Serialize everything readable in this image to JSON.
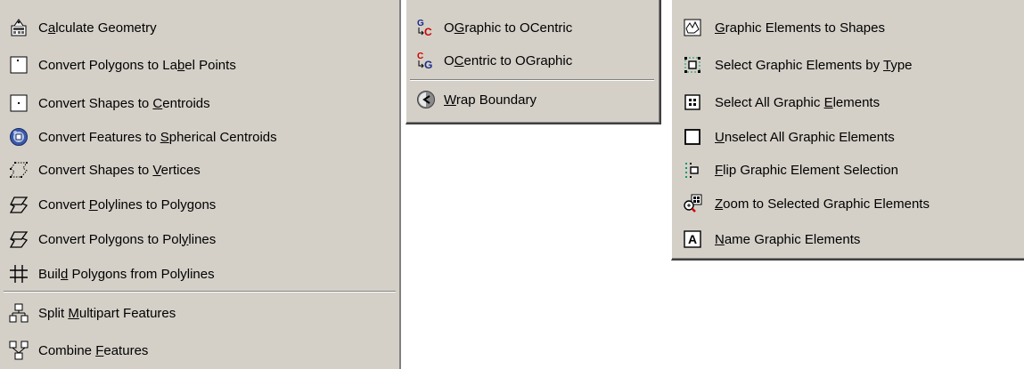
{
  "menu1": {
    "items": [
      {
        "pre": "C",
        "u": "a",
        "post": "lculate Geometry",
        "icon": "calculate-geometry-icon"
      },
      {
        "pre": "Convert Polygons to La",
        "u": "b",
        "post": "el Points",
        "icon": "label-points-icon"
      },
      {
        "pre": "Convert Shapes to ",
        "u": "C",
        "post": "entroids",
        "icon": "centroid-icon"
      },
      {
        "pre": "Convert Features to ",
        "u": "S",
        "post": "pherical Centroids",
        "icon": "spherical-centroid-icon"
      },
      {
        "pre": "Convert Shapes to ",
        "u": "V",
        "post": "ertices",
        "icon": "vertices-icon"
      },
      {
        "pre": "Convert ",
        "u": "P",
        "post": "olylines to Polygons",
        "icon": "polylines-to-polygons-icon"
      },
      {
        "pre": "Convert Polygons to Pol",
        "u": "y",
        "post": "lines",
        "icon": "polygons-to-polylines-icon"
      },
      {
        "pre": "Buil",
        "u": "d",
        "post": " Polygons from Polylines",
        "icon": "build-polygons-icon"
      },
      {
        "pre": "Split ",
        "u": "M",
        "post": "ultipart Features",
        "icon": "split-multipart-icon"
      },
      {
        "pre": "Combine ",
        "u": "F",
        "post": "eatures",
        "icon": "combine-features-icon"
      }
    ]
  },
  "menu2": {
    "items": [
      {
        "pre": "O",
        "u": "G",
        "post": "raphic to OCentric",
        "icon": "graphic-to-centric-icon",
        "badge_top": "G",
        "badge_bottom": "C"
      },
      {
        "pre": "O",
        "u": "C",
        "post": "entric to OGraphic",
        "icon": "centric-to-graphic-icon",
        "badge_top": "C",
        "badge_bottom": "G"
      },
      {
        "pre": "",
        "u": "W",
        "post": "rap Boundary",
        "icon": "wrap-boundary-icon"
      }
    ]
  },
  "menu3": {
    "items": [
      {
        "pre": "",
        "u": "G",
        "post": "raphic Elements to Shapes",
        "icon": "graphic-to-shapes-icon"
      },
      {
        "pre": "Select Graphic Elements by ",
        "u": "T",
        "post": "ype",
        "icon": "select-by-type-icon"
      },
      {
        "pre": "Select All Graphic ",
        "u": "E",
        "post": "lements",
        "icon": "select-all-icon"
      },
      {
        "pre": "",
        "u": "U",
        "post": "nselect All Graphic Elements",
        "icon": "unselect-all-icon"
      },
      {
        "pre": "",
        "u": "F",
        "post": "lip Graphic Element Selection",
        "icon": "flip-selection-icon"
      },
      {
        "pre": "",
        "u": "Z",
        "post": "oom to Selected Graphic Elements",
        "icon": "zoom-selected-icon"
      },
      {
        "pre": "",
        "u": "N",
        "post": "ame Graphic Elements",
        "icon": "name-graphic-icon",
        "badge": "A"
      }
    ]
  },
  "colors": {
    "menu_bg": "#d4d0c8",
    "shadow": "#808080",
    "highlight": "#ffffff",
    "accent_red": "#cc0000",
    "accent_blue": "#1a2a8a",
    "accent_green": "#009966"
  }
}
